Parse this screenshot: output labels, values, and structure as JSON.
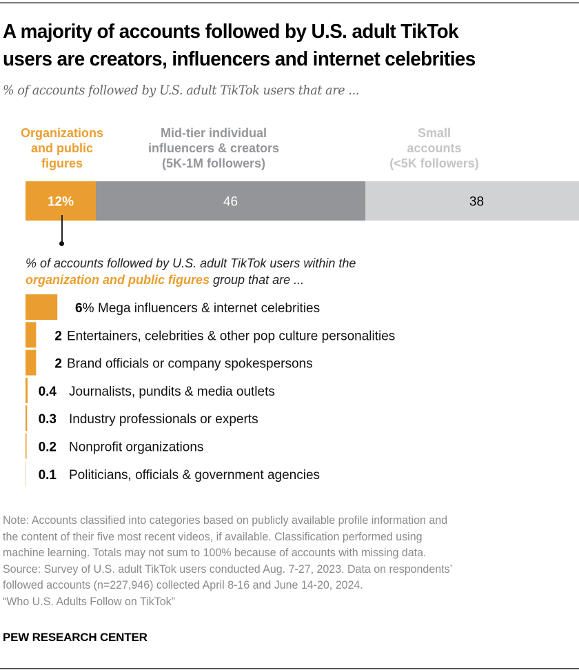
{
  "title_lines": [
    "A majority of accounts followed by U.S. adult TikTok",
    "users are creators, influencers and internet celebrities"
  ],
  "subtitle": "% of accounts followed by U.S. adult TikTok users that are ...",
  "colors": {
    "orange": "#EA9E2F",
    "dark_gray": "#939598",
    "light_gray": "#D1D2D4",
    "small_label": "#C4C5C7"
  },
  "chart_data": [
    {
      "type": "bar",
      "orientation": "horizontal-stacked",
      "title": "% of accounts followed by U.S. adult TikTok users that are ...",
      "categories": [
        "Organizations and public figures",
        "Mid-tier individual influencers & creators (5K-1M followers)",
        "Small accounts (<5K followers)"
      ],
      "segments": [
        {
          "name": "Organizations and public figures",
          "label_lines": [
            "Organizations",
            "and public",
            "figures"
          ],
          "value": 12,
          "value_label": "12%",
          "color": "#EA9E2F",
          "text_color": "#ffffff",
          "label_color": "#EA9E2F"
        },
        {
          "name": "Mid-tier individual influencers & creators (5K-1M followers)",
          "label_lines": [
            "Mid-tier individual",
            "influencers & creators",
            "(5K-1M followers)"
          ],
          "value": 46,
          "value_label": "46",
          "color": "#939598",
          "text_color": "#ffffff",
          "label_color": "#939598"
        },
        {
          "name": "Small accounts (<5K followers)",
          "label_lines": [
            "Small",
            "accounts",
            "(<5K followers)"
          ],
          "value": 38,
          "value_label": "38",
          "color": "#D1D2D4",
          "text_color": "#000000",
          "label_color": "#C4C5C7"
        }
      ],
      "xlim": [
        0,
        100
      ]
    },
    {
      "type": "bar",
      "orientation": "horizontal",
      "title_parts": [
        {
          "text": "% of accounts followed by U.S. adult TikTok users within the",
          "highlight": false
        },
        {
          "text": "organization and public figures",
          "highlight": true
        },
        {
          "text": " group that are ...",
          "highlight": false
        }
      ],
      "categories": [
        "Mega influencers & internet celebrities",
        "Entertainers, celebrities & other pop culture personalities",
        "Brand officials or company spokespersons",
        "Journalists, pundits & media outlets",
        "Industry professionals or experts",
        "Nonprofit organizations",
        "Politicians, officials & government agencies"
      ],
      "values": [
        6,
        2,
        2,
        0.4,
        0.3,
        0.2,
        0.1
      ],
      "value_labels": [
        "6%",
        "2",
        "2",
        "0.4",
        "0.3",
        "0.2",
        "0.1"
      ],
      "color": "#EA9E2F",
      "xlim": [
        0,
        12
      ]
    }
  ],
  "notes": [
    "Note: Accounts classified into categories based on publicly available profile information and",
    "the content of their five most recent videos, if available. Classification performed using",
    "machine learning. Totals may not sum to 100% because of accounts with missing data.",
    "Source: Survey of U.S. adult TikTok users conducted Aug. 7-27, 2023. Data on respondents’",
    "followed accounts (n=227,946) collected April 8-16 and June 14-20, 2024.",
    "“Who U.S. Adults Follow on TikTok”"
  ],
  "brand": "PEW RESEARCH CENTER"
}
